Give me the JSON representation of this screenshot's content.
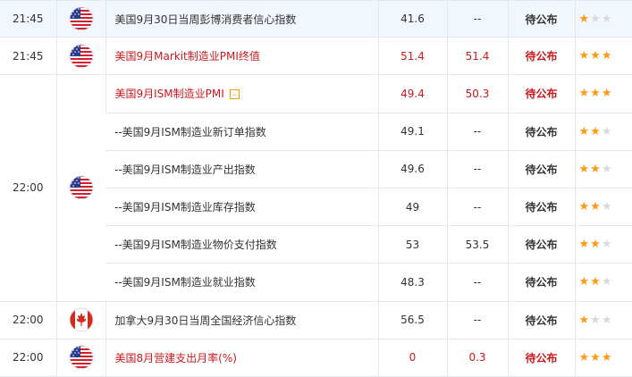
{
  "events": [
    {
      "time": "21:45",
      "country": "us",
      "name": "美国9月30日当周彭博消费者信心指数",
      "previous": "41.6",
      "forecast": "--",
      "actual": "待公布",
      "stars": 1,
      "important": false
    },
    {
      "time": "21:45",
      "country": "us",
      "name": "美国9月Markit制造业PMI终值",
      "previous": "51.4",
      "forecast": "51.4",
      "actual": "待公布",
      "stars": 3,
      "important": true
    },
    {
      "time": "22:00",
      "country": "us",
      "name": "美国9月ISM制造业PMI",
      "previous": "49.4",
      "forecast": "50.3",
      "actual": "待公布",
      "stars": 3,
      "important": true,
      "toggle": "-"
    },
    {
      "time": "",
      "country": "",
      "name": "--美国9月ISM制造业新订单指数",
      "previous": "49.1",
      "forecast": "--",
      "actual": "待公布",
      "stars": 2,
      "important": false
    },
    {
      "time": "",
      "country": "",
      "name": "--美国9月ISM制造业产出指数",
      "previous": "49.6",
      "forecast": "--",
      "actual": "待公布",
      "stars": 2,
      "important": false
    },
    {
      "time": "",
      "country": "",
      "name": "--美国9月ISM制造业库存指数",
      "previous": "49",
      "forecast": "--",
      "actual": "待公布",
      "stars": 2,
      "important": false
    },
    {
      "time": "",
      "country": "",
      "name": "--美国9月ISM制造业物价支付指数",
      "previous": "53",
      "forecast": "53.5",
      "actual": "待公布",
      "stars": 2,
      "important": false
    },
    {
      "time": "",
      "country": "",
      "name": "--美国9月ISM制造业就业指数",
      "previous": "48.3",
      "forecast": "--",
      "actual": "待公布",
      "stars": 2,
      "important": false
    },
    {
      "time": "22:00",
      "country": "ca",
      "name": "加拿大9月30日当周全国经济信心指数",
      "previous": "56.5",
      "forecast": "--",
      "actual": "待公布",
      "stars": 1,
      "important": false
    },
    {
      "time": "22:00",
      "country": "us",
      "name": "美国8月营建支出月率(%)",
      "previous": "0",
      "forecast": "0.3",
      "actual": "待公布",
      "stars": 3,
      "important": true
    }
  ],
  "colors": {
    "important_text": "#c8191f",
    "normal_text": "#333333",
    "star_on": "#ff9a14",
    "star_off": "#d9d9d9",
    "highlight_row": "#f2f6fd"
  },
  "icons": {
    "us": "us-flag-icon",
    "ca": "canada-flag-icon",
    "toggle": "collapse-toggle-icon",
    "star": "star-icon"
  }
}
